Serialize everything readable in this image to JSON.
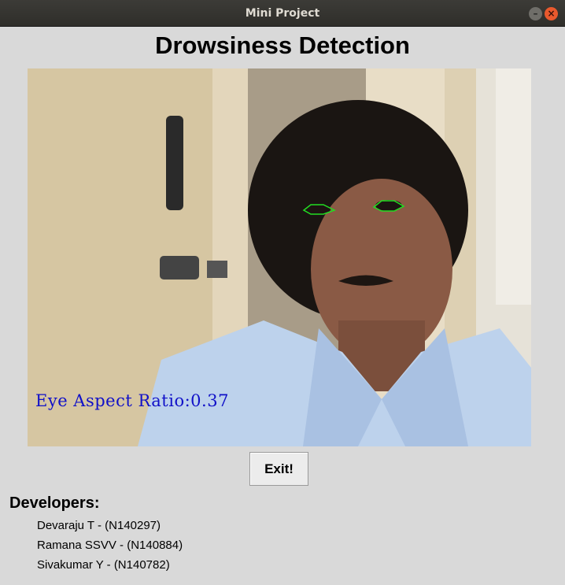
{
  "window": {
    "title": "Mini Project"
  },
  "heading": "Drowsiness Detection",
  "video": {
    "overlay_text": "Eye Aspect Ratio:0.37",
    "overlay_color": "#1010c8",
    "eye_contour_color": "#22dd22"
  },
  "exit_button": {
    "label": "Exit!"
  },
  "developers": {
    "heading": "Developers:",
    "items": [
      "Devaraju T - (N140297)",
      "Ramana SSVV - (N140884)",
      "Sivakumar Y - (N140782)"
    ]
  }
}
